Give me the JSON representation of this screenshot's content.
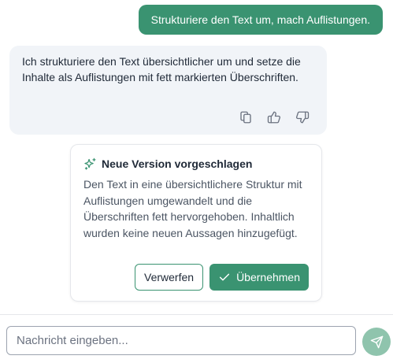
{
  "user_message": {
    "text": "Strukturiere den Text um, mach Auflistungen."
  },
  "assistant_message": {
    "text": "Ich strukturiere den Text übersichtlicher um und setze die Inhalte als Auflistungen mit fett markierten Überschriften.",
    "actions": {
      "copy_icon": "copy-icon",
      "thumbs_up_icon": "thumbs-up-icon",
      "thumbs_down_icon": "thumbs-down-icon"
    }
  },
  "suggestion": {
    "icon": "sparkle-icon",
    "title": "Neue Version vorgeschlagen",
    "body": "Den Text in eine übersichtlichere Struktur mit Auflistungen umgewandelt und die Überschriften fett hervorgehoben. Inhaltlich wurden keine neuen Aussagen hinzugefügt.",
    "discard_label": "Verwerfen",
    "accept_label": "Übernehmen"
  },
  "composer": {
    "value": "",
    "placeholder": "Nachricht eingeben..."
  },
  "colors": {
    "accent": "#3a9371",
    "send_button": "#8fc4ad",
    "assistant_bubble": "#f1f4f8"
  }
}
